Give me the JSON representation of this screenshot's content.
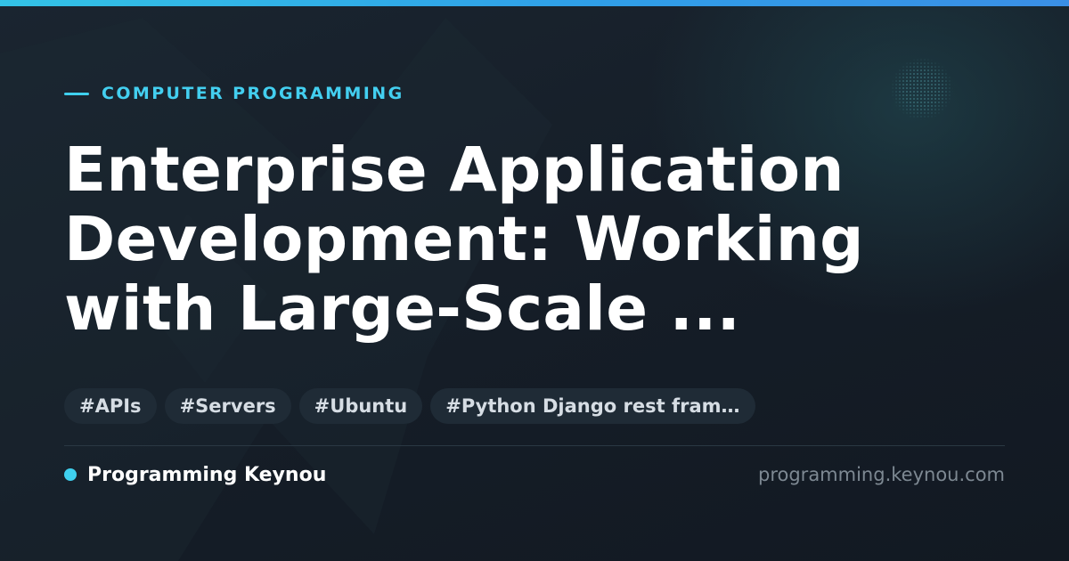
{
  "category": "COMPUTER PROGRAMMING",
  "title_lines": [
    "Enterprise Application",
    "Development: Working",
    "with Large-Scale ..."
  ],
  "tags": [
    "#APIs",
    "#Servers",
    "#Ubuntu",
    "#Python Django rest fram…"
  ],
  "brand": "Programming Keynou",
  "domain": "programming.keynou.com",
  "colors": {
    "accent": "#3fd0ee",
    "background": "#141b24",
    "tag_background": "#1f2b36"
  },
  "icons": {
    "category_marker": "dash-icon",
    "brand_marker": "dot-icon",
    "background_mark": "watermark-logo"
  }
}
